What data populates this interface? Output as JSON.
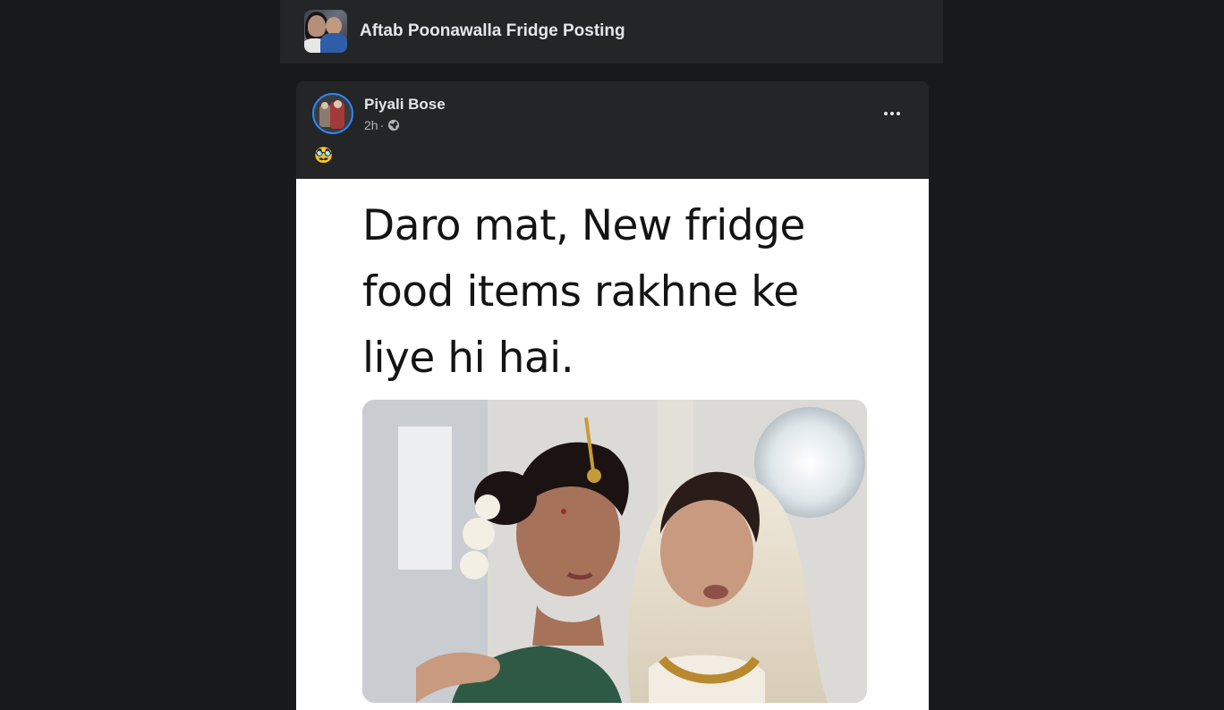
{
  "group": {
    "title": "Aftab Poonawalla Fridge Posting"
  },
  "post": {
    "author": "Piyali Bose",
    "time": "2h",
    "separator": "·",
    "emoji": "🥸",
    "meme_text": "Daro mat, New fridge food items rakhne ke liye hi hai."
  },
  "icons": {
    "more": "more-options-icon",
    "privacy": "globe-icon"
  },
  "colors": {
    "background": "#18191a",
    "card": "#242526",
    "text_primary": "#e4e6eb",
    "text_secondary": "#b0b3b8",
    "avatar_ring": "#2d88ff"
  }
}
